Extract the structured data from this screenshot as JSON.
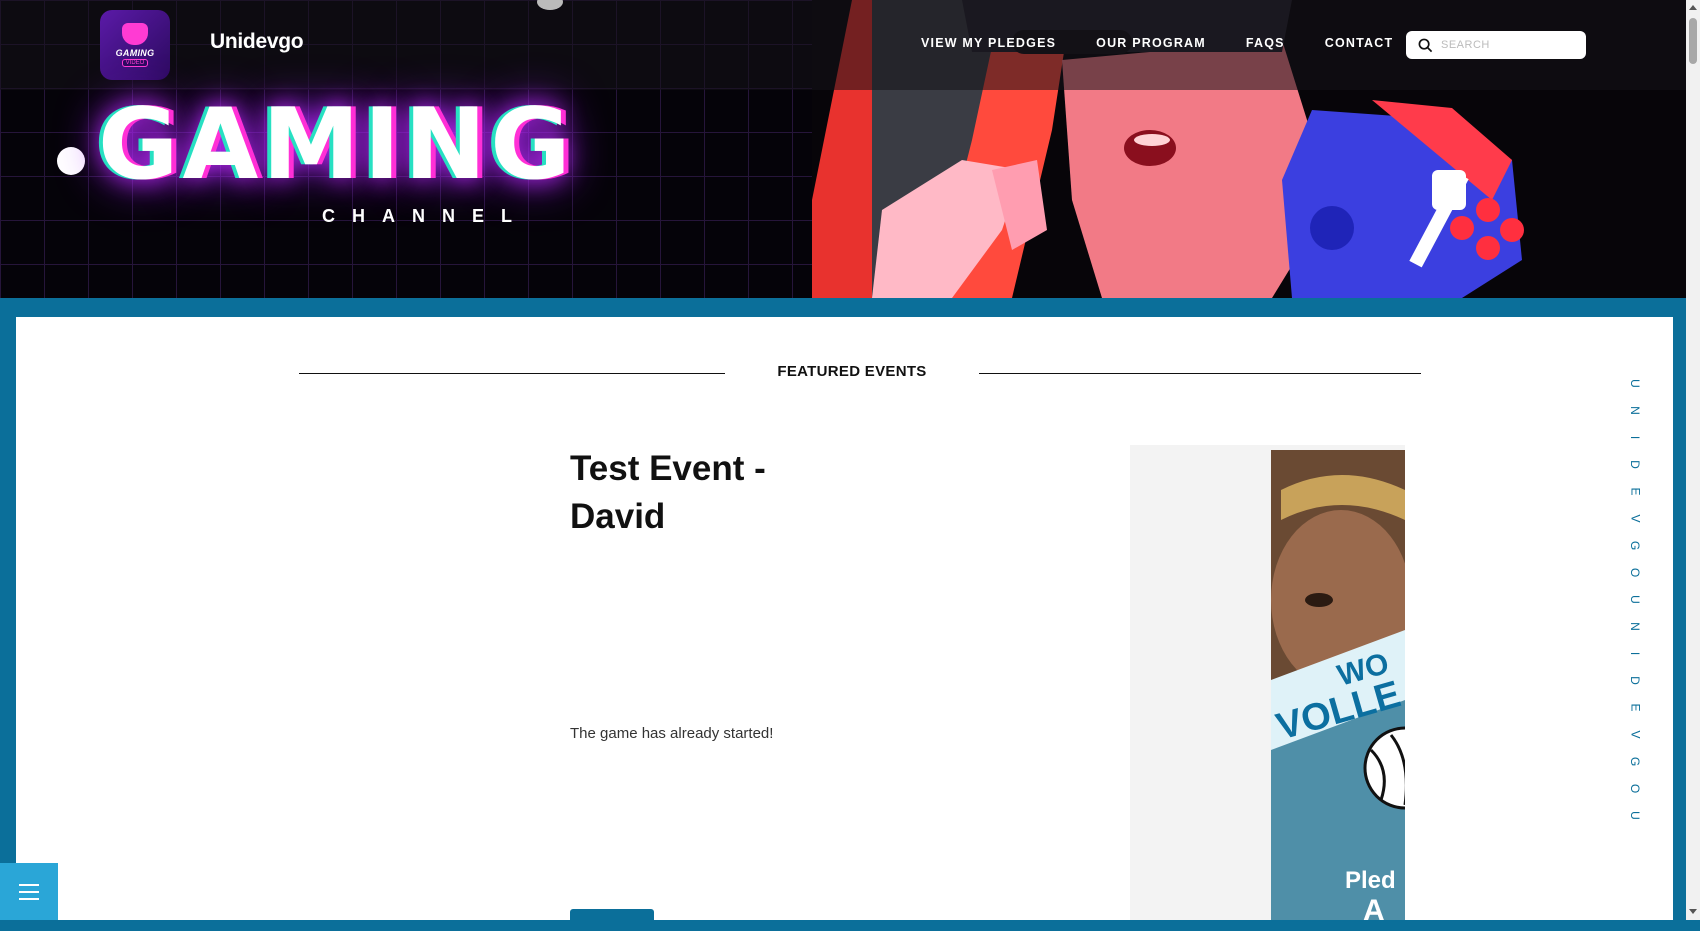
{
  "header": {
    "logo_text": "GAMING",
    "logo_sub": "VIDEO",
    "brand": "Unidevgo",
    "nav": [
      "VIEW MY PLEDGES",
      "OUR PROGRAM",
      "FAQS",
      "CONTACT"
    ],
    "search_placeholder": "SEARCH"
  },
  "hero": {
    "title": "GAMING",
    "subtitle": "CHANNEL"
  },
  "main": {
    "section_title": "FEATURED EVENTS",
    "event": {
      "title": "Test Event - David",
      "status": "The game has already started!"
    },
    "promo": {
      "text1": "WO",
      "text2": "VOLLE",
      "text3": "Pled",
      "text4": "A"
    }
  },
  "side_text": [
    "U",
    "N",
    "I",
    "D",
    "E",
    "V",
    "G",
    "O"
  ],
  "colors": {
    "accent": "#0b6f9a",
    "menu_button": "#2aa6d7",
    "neon_pink": "#ff2fd6",
    "neon_teal": "#27e0c2"
  },
  "icons": {
    "search": "search-icon",
    "menu": "hamburger-menu-icon"
  }
}
